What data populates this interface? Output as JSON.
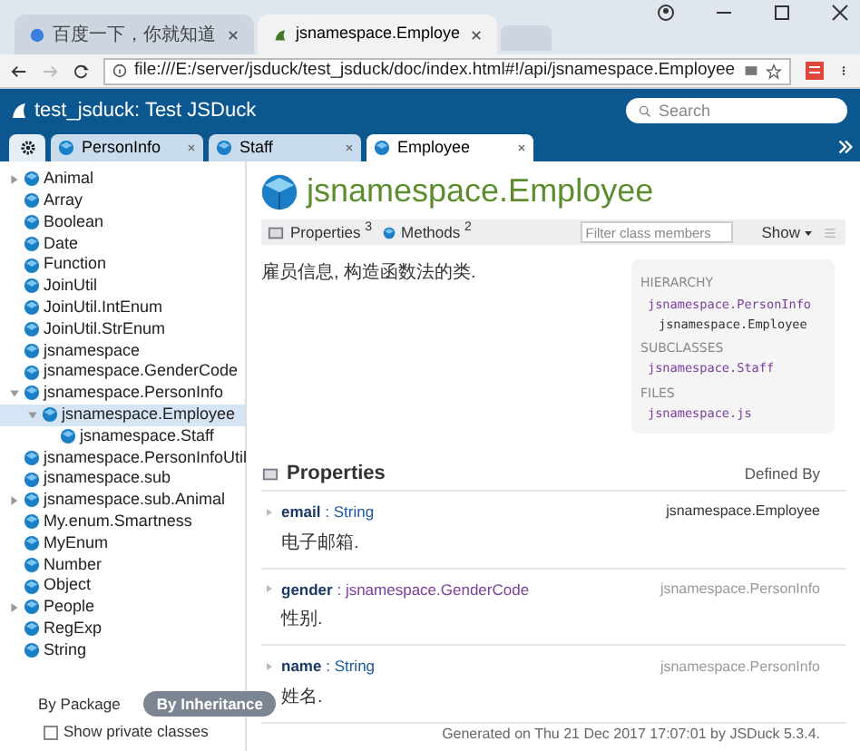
{
  "browser": {
    "tabs": [
      {
        "label": "百度一下，你就知道",
        "selected": false
      },
      {
        "label": "jsnamespace.Employe",
        "selected": true
      }
    ],
    "url": "file:///E:/server/jsduck/test_jsduck/doc/index.html#!/api/jsnamespace.Employee"
  },
  "header": {
    "title": "test_jsduck: Test JSDuck",
    "search": {
      "placeholder": "Search"
    },
    "tabs": [
      {
        "label": "PersonInfo",
        "selected": false
      },
      {
        "label": "Staff",
        "selected": false
      },
      {
        "label": "Employee",
        "selected": true
      }
    ]
  },
  "sidebar": {
    "items": [
      {
        "label": "Animal",
        "expanded": false
      },
      {
        "label": "Array"
      },
      {
        "label": "Boolean"
      },
      {
        "label": "Date"
      },
      {
        "label": "Function"
      },
      {
        "label": "JoinUtil"
      },
      {
        "label": "JoinUtil.IntEnum"
      },
      {
        "label": "JoinUtil.StrEnum"
      },
      {
        "label": "jsnamespace"
      },
      {
        "label": "jsnamespace.GenderCode"
      },
      {
        "label": "jsnamespace.PersonInfo",
        "expanded": true,
        "children": [
          {
            "label": "jsnamespace.Employee",
            "expanded": true,
            "selected": true,
            "children": [
              {
                "label": "jsnamespace.Staff"
              }
            ]
          }
        ]
      },
      {
        "label": "jsnamespace.PersonInfoUtil"
      },
      {
        "label": "jsnamespace.sub"
      },
      {
        "label": "jsnamespace.sub.Animal",
        "expanded": false
      },
      {
        "label": "My.enum.Smartness"
      },
      {
        "label": "MyEnum"
      },
      {
        "label": "Number"
      },
      {
        "label": "Object"
      },
      {
        "label": "People",
        "expanded": false
      },
      {
        "label": "RegExp"
      },
      {
        "label": "String"
      }
    ],
    "views": [
      {
        "label": "By Package",
        "selected": false
      },
      {
        "label": "By Inheritance",
        "selected": true
      }
    ],
    "private": {
      "label": "Show private classes",
      "checked": false
    }
  },
  "doc": {
    "title": "jsnamespace.Employee",
    "toolbar": {
      "links": [
        {
          "label": "Properties",
          "count": "3"
        },
        {
          "label": "Methods",
          "count": "2"
        }
      ],
      "filter": {
        "placeholder": "Filter class members"
      },
      "show": "Show"
    },
    "description": "雇员信息, 构造函数法的类.",
    "meta": {
      "sections": [
        {
          "heading": "HIERARCHY",
          "items": [
            "jsnamespace.PersonInfo",
            "jsnamespace.Employee"
          ]
        },
        {
          "heading": "SUBCLASSES",
          "items": [
            "jsnamespace.Staff"
          ]
        },
        {
          "heading": "FILES",
          "items": [
            "jsnamespace.js"
          ]
        }
      ]
    },
    "properties": {
      "heading": "Properties",
      "defined_by": "Defined By",
      "members": [
        {
          "name": "email",
          "type": ": String",
          "owner": "jsnamespace.Employee",
          "inherited": false,
          "desc": "电子邮箱."
        },
        {
          "name": "gender",
          "type": ": jsnamespace.GenderCode",
          "owner": "jsnamespace.PersonInfo",
          "inherited": true,
          "desc": "性别."
        },
        {
          "name": "name",
          "type": ": String",
          "owner": "jsnamespace.PersonInfo",
          "inherited": true,
          "desc": "姓名."
        }
      ]
    },
    "footer": "Generated on Thu 21 Dec 2017 17:07:01 by JSDuck 5.3.4."
  }
}
